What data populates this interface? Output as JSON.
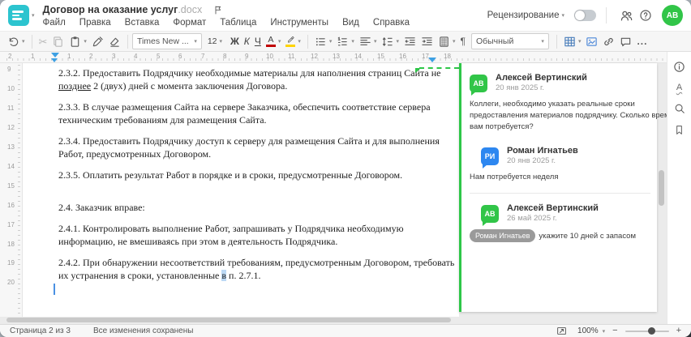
{
  "header": {
    "title": "Договор на оказание услуг",
    "title_ext": ".docx",
    "menu": [
      "Файл",
      "Правка",
      "Вставка",
      "Формат",
      "Таблица",
      "Инструменты",
      "Вид",
      "Справка"
    ],
    "review_label": "Рецензирование",
    "avatar_initials": "АВ"
  },
  "toolbar": {
    "font_name": "Times New ...",
    "font_size": "12",
    "bold": "Ж",
    "italic": "К",
    "underline": "Ч",
    "font_color_letter": "А",
    "style_name": "Обычный",
    "paragraph_mark": "¶",
    "more": "..."
  },
  "ruler": {
    "h_left": [
      "2",
      "1"
    ],
    "h": [
      "1",
      "2",
      "3",
      "4",
      "5",
      "6",
      "7",
      "8",
      "9",
      "10",
      "11",
      "12",
      "13",
      "14",
      "15",
      "16",
      "17",
      "18"
    ],
    "v": [
      "9",
      "10",
      "11",
      "12",
      "13",
      "14",
      "15",
      "16",
      "17",
      "18",
      "19",
      "20"
    ]
  },
  "document": {
    "para_232_l1": "2.3.2. Предоставить Подрядчику необходимые материалы для наполнения страниц Сайта не",
    "para_232_l2_u": "позднее",
    "para_232_l2_rest": " 2 (двух) дней с момента заключения Договора.",
    "para_233_l1": "2.3.3. В случае размещения Сайта на сервере Заказчика, обеспечить соответствие сервера",
    "para_233_l2": "техническим требованиям для размещения Сайта.",
    "para_234_l1": "2.3.4. Предоставить Подрядчику доступ к серверу для размещения Сайта и для выполнения",
    "para_234_l2": "Работ, предусмотренных Договором.",
    "para_235_l1": "2.3.5. Оплатить результат Работ в порядке и в сроки, предусмотренные Договором.",
    "para_24_l1": "2.4. Заказчик вправе:",
    "para_241_l1": "2.4.1. Контролировать выполнение Работ, запрашивать у Подрядчика необходимую",
    "para_241_l2": "информацию, не вмешиваясь при этом в деятельность Подрядчика.",
    "para_242_l1": "2.4.2. При обнаружении несоответствий требованиям, предусмотренным Договором, требовать",
    "para_242_l2_pre": "их устранения в сроки, установленные ",
    "para_242_l2_hl": "в",
    "para_242_l2_rest": " п. 2.7.1."
  },
  "comments": {
    "c1": {
      "initials": "АВ",
      "name": "Алексей Вертинский",
      "date": "20 янв 2025 г.",
      "l1": "Коллеги, необходимо указать реальные сроки",
      "l2": "предоставления материалов подрядчику. Сколько времени",
      "l3": "вам потребуется?"
    },
    "c2": {
      "initials": "РИ",
      "name": "Роман Игнатьев",
      "date": "20 янв 2025 г.",
      "l1": "Нам потребуется неделя"
    },
    "c3": {
      "initials": "АВ",
      "name": "Алексей Вертинский",
      "date": "26 май 2025 г.",
      "mention": "Роман Игнатьев",
      "text": "укажите 10 дней с запасом"
    }
  },
  "statusbar": {
    "page_info": "Страница 2 из 3",
    "saved_info": "Все изменения сохранены",
    "zoom_value": "100%",
    "zoom_out": "−",
    "zoom_in": "+"
  },
  "colors": {
    "brand_teal": "#2cc4cf",
    "comment_green": "#31c548",
    "reply_blue": "#2d87f0",
    "ruler_marker_blue": "#3da0e3"
  }
}
